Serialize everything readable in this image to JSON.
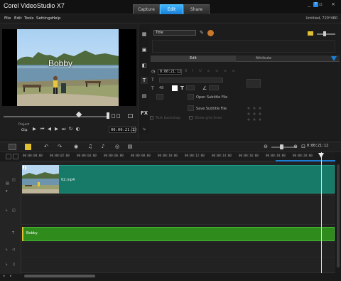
{
  "app": {
    "title": "Corel VideoStudio X7",
    "mode_tabs": [
      {
        "label": "Capture"
      },
      {
        "label": "Edit"
      },
      {
        "label": "Share"
      }
    ],
    "window_buttons": "_ ▫ ×",
    "help_icon": "?",
    "project_info": "Untitled, 720*480"
  },
  "menu": [
    "File",
    "Edit",
    "Tools",
    "Settings",
    "Help"
  ],
  "player": {
    "caption": "Bobby",
    "mode_project": "Project",
    "mode_clip": "Clip",
    "timecode": "00:00:21:12",
    "scrub_progress": 0.73
  },
  "options": {
    "title_dropdown": "Title",
    "tabs": [
      {
        "label": "Edit"
      },
      {
        "label": "Attribute"
      }
    ],
    "duration": "0:00:21:12",
    "font_size": "48",
    "open_subtitle": "Open Subtitle File",
    "save_subtitle": "Save Subtitle File",
    "text_backdrop": "Text backdrop",
    "show_grid": "Show grid lines"
  },
  "timeline": {
    "ruler_ticks": [
      "00:00:00:00",
      "00:00:02:00",
      "00:00:04:00",
      "00:00:06:00",
      "00:00:08:00",
      "00:00:10:00",
      "00:00:12:00",
      "00:00:14:00",
      "00:00:16:00",
      "00:00:18:00",
      "00:00:20:00"
    ],
    "timecode": "0:00:21:12",
    "zoom_level": 0.4,
    "clips": {
      "video": "02.mp4",
      "title": "Bobby"
    }
  },
  "colors": {
    "accent": "#1b7fd6",
    "video_clip": "#177a68",
    "title_clip": "#2e8b1c"
  }
}
